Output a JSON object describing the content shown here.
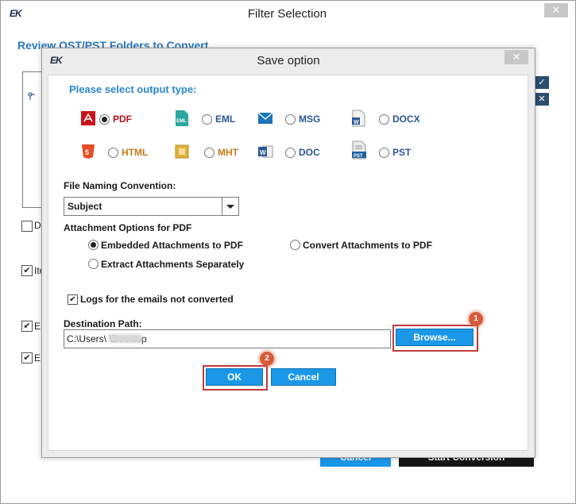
{
  "outer": {
    "logo": "EK",
    "title": "Filter Selection",
    "close": "✕",
    "heading": "Review OST/PST Folders to Convert",
    "checkboxes": [
      {
        "label": "De",
        "checked": false
      },
      {
        "label": "Ite",
        "checked": true
      },
      {
        "label": "E:",
        "checked": true
      },
      {
        "label": "E:",
        "checked": true
      }
    ],
    "side_buttons": [
      "✓",
      "✕"
    ],
    "cancel_label": "Cancel",
    "start_label": "Start Conversion"
  },
  "dialog": {
    "logo": "EK",
    "title": "Save option",
    "close": "✕",
    "output_type_title": "Please select output type:",
    "formats": [
      {
        "label": "PDF",
        "icon": "pdf-icon",
        "selected": true
      },
      {
        "label": "EML",
        "icon": "eml-icon",
        "selected": false
      },
      {
        "label": "MSG",
        "icon": "msg-icon",
        "selected": false
      },
      {
        "label": "DOCX",
        "icon": "docx-icon",
        "selected": false
      },
      {
        "label": "HTML",
        "icon": "html-icon",
        "selected": false
      },
      {
        "label": "MHT",
        "icon": "mht-icon",
        "selected": false
      },
      {
        "label": "DOC",
        "icon": "doc-icon",
        "selected": false
      },
      {
        "label": "PST",
        "icon": "pst-icon",
        "selected": false
      }
    ],
    "naming_label": "File Naming Convention:",
    "naming_value": "Subject",
    "attachment_label": "Attachment Options for PDF",
    "attachment_options": [
      {
        "label": "Embedded Attachments to PDF",
        "selected": true
      },
      {
        "label": "Convert Attachments to PDF",
        "selected": false
      },
      {
        "label": "Extract Attachments Separately",
        "selected": false
      }
    ],
    "logs_label": "Logs for the emails not converted",
    "logs_checked": true,
    "destination_label": "Destination Path:",
    "destination_value": "C:\\Users\\        \\Desktop",
    "browse_label": "Browse...",
    "ok_label": "OK",
    "cancel_label": "Cancel",
    "markers": [
      "1",
      "2"
    ]
  },
  "colors": {
    "accent": "#1b97e8",
    "heading": "#2a87d0",
    "highlight": "#c23a3a",
    "marker": "#d85a3a"
  }
}
